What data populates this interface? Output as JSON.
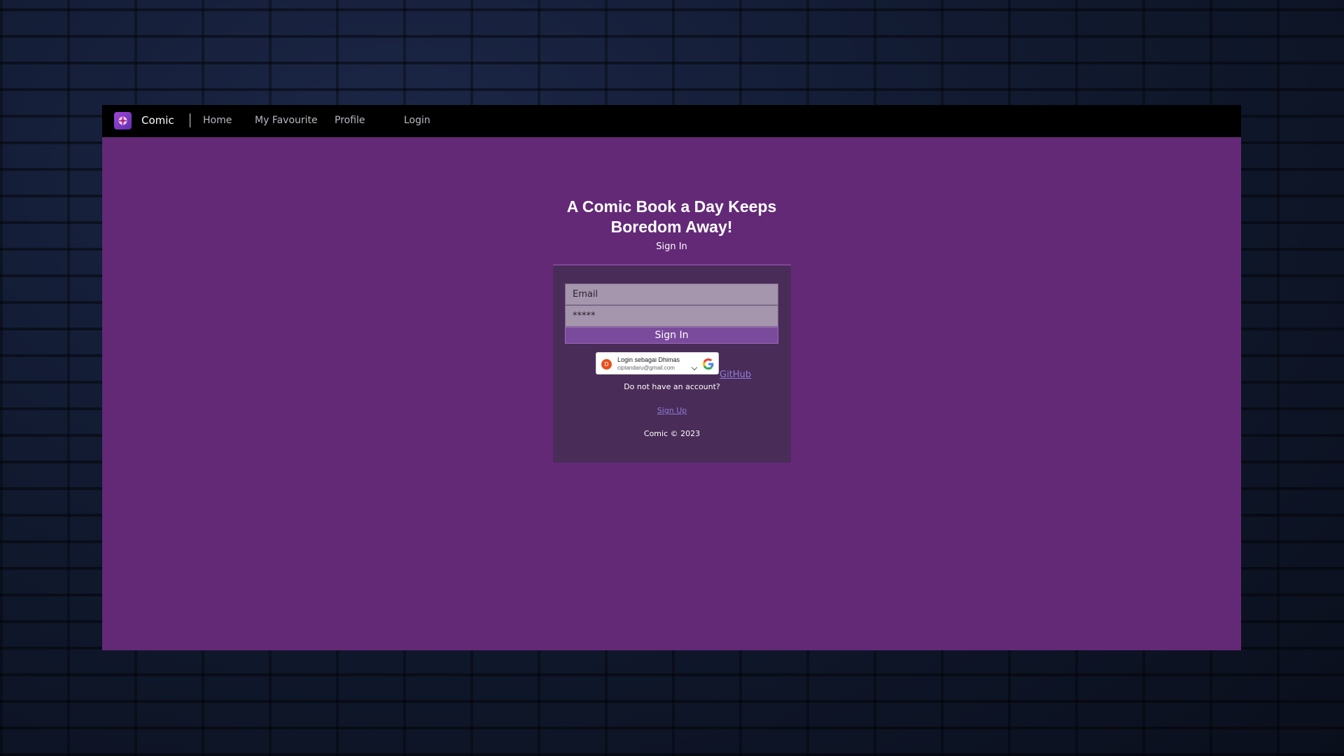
{
  "navbar": {
    "brand": "Comic",
    "links": [
      {
        "label": "Home"
      },
      {
        "label": "My Favourite"
      },
      {
        "label": "Profile"
      },
      {
        "label": "Login"
      }
    ]
  },
  "hero": {
    "title_line1": "A Comic Book a Day Keeps",
    "title_line2": "Boredom Away!",
    "subtitle": "Sign In"
  },
  "form": {
    "email_placeholder": "Email",
    "password_value": "*****",
    "submit_label": "Sign In",
    "google": {
      "avatar_letter": "D",
      "name": "Login sebagai Dhimas",
      "email": "ciptandaru@gmail.com"
    },
    "github_label": "GitHub",
    "no_account_text": "Do not have an account?",
    "signup_label": "Sign Up",
    "footer": "Comic © 2023"
  },
  "colors": {
    "navbar_bg": "#000000",
    "main_bg": "#632977",
    "card_bg": "#4a2c58",
    "link": "#8d7dd8"
  }
}
